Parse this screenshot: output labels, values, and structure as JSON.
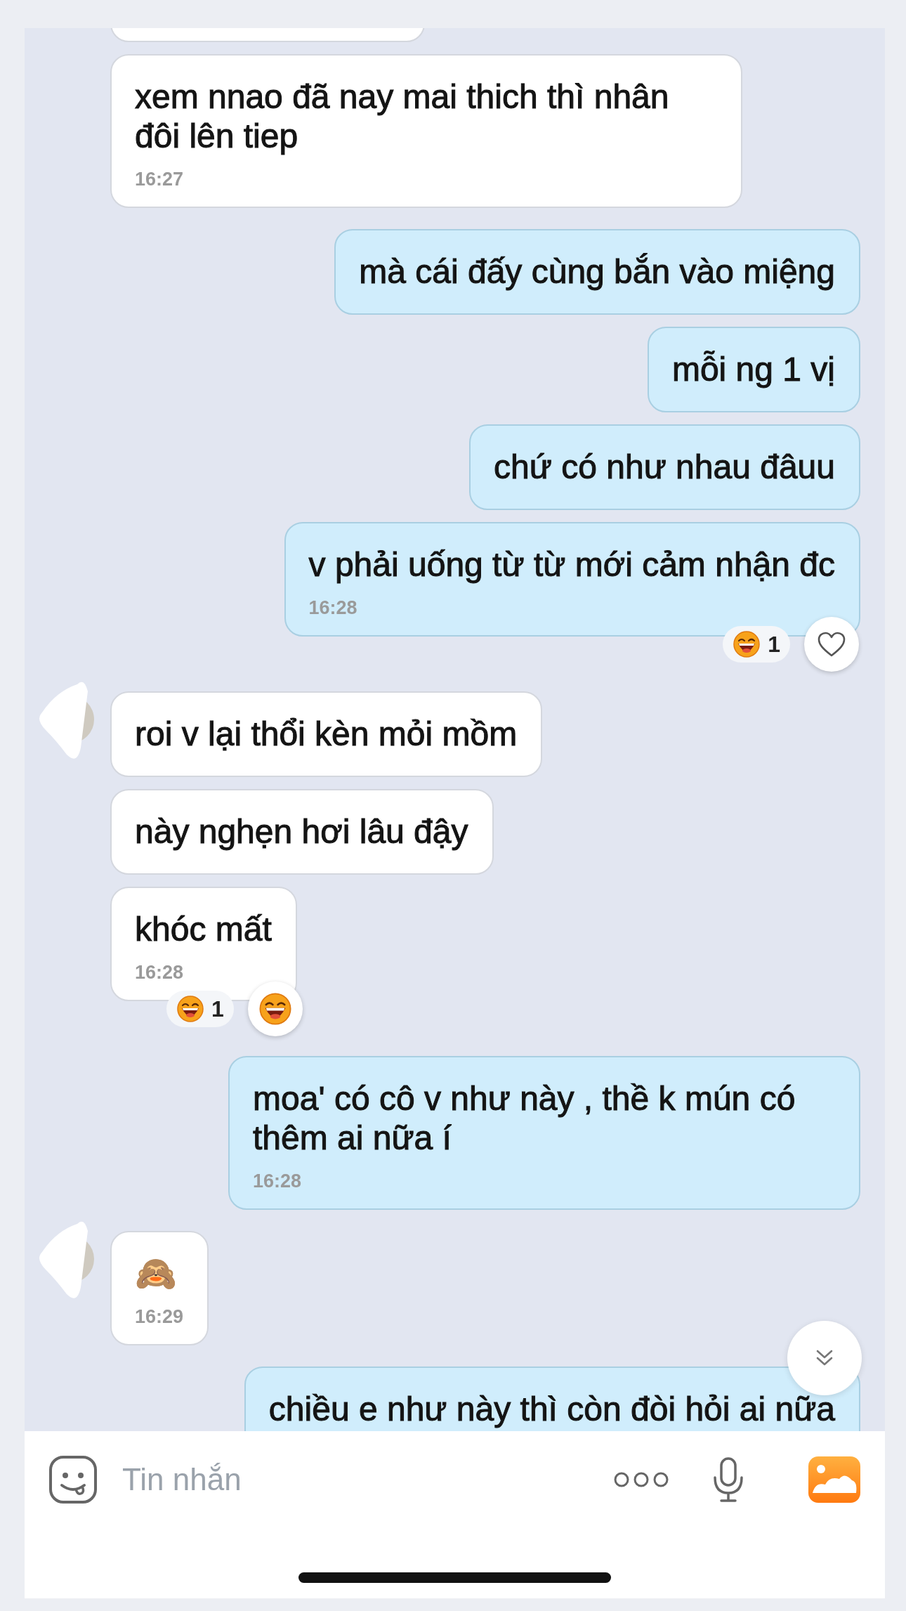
{
  "messages": [
    {
      "kind": "cut_off",
      "outgoing": false
    },
    {
      "kind": "text",
      "outgoing": false,
      "text": "xem nnao đã nay mai thich thì nhân đôi lên tiep",
      "time": "16:27"
    },
    {
      "kind": "text",
      "outgoing": true,
      "text": "mà cái đấy cùng bắn vào miệng"
    },
    {
      "kind": "text",
      "outgoing": true,
      "text": "mỗi ng 1 vị"
    },
    {
      "kind": "text",
      "outgoing": true,
      "text": "chứ có như nhau đâuu"
    },
    {
      "kind": "text",
      "outgoing": true,
      "text": "v phải uống từ từ mới cảm nhận đc",
      "time": "16:28",
      "reactions": {
        "count": "1",
        "reacted": false
      }
    },
    {
      "kind": "text",
      "outgoing": false,
      "avatar": true,
      "text": "roi v lại thổi kèn mỏi mồm"
    },
    {
      "kind": "text",
      "outgoing": false,
      "text": "này nghẹn hơi lâu đậy"
    },
    {
      "kind": "text",
      "outgoing": false,
      "text": "khóc mất",
      "time": "16:28",
      "reactions": {
        "count": "1",
        "reacted": true
      }
    },
    {
      "kind": "text",
      "outgoing": true,
      "text": "moa' có cô v như này , thề k mún có thêm ai nữa í",
      "time": "16:28"
    },
    {
      "kind": "text",
      "outgoing": false,
      "avatar": true,
      "text": "🙈",
      "time": "16:29"
    },
    {
      "kind": "text",
      "outgoing": true,
      "text": "chiều e như này thì còn đòi hỏi ai nữa"
    }
  ],
  "composer": {
    "placeholder": "Tin nhắn"
  }
}
